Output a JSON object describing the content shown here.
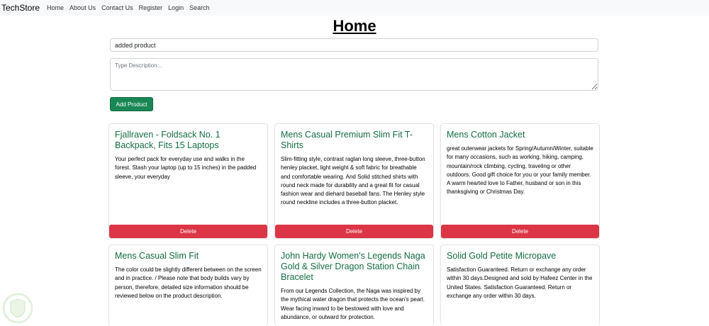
{
  "navbar": {
    "brand": "TechStore",
    "links": [
      "Home",
      "About Us",
      "Contact Us",
      "Register",
      "Login",
      "Search"
    ]
  },
  "page": {
    "title": "Home"
  },
  "form": {
    "title_value": "added product",
    "description_placeholder": "Type Description...",
    "add_button": "Add Product"
  },
  "products": [
    {
      "title": "Fjallraven - Foldsack No. 1 Backpack, Fits 15 Laptops",
      "description": "Your perfect pack for everyday use and walks in the forest. Stash your laptop (up to 15 inches) in the padded sleeve, your everyday",
      "delete_label": "Delete"
    },
    {
      "title": "Mens Casual Premium Slim Fit T-Shirts",
      "description": "Slim-fitting style, contrast raglan long sleeve, three-button henley placket, light weight & soft fabric for breathable and comfortable wearing. And Solid stitched shirts with round neck made for durability and a great fit for casual fashion wear and diehard baseball fans. The Henley style round neckline includes a three-button placket.",
      "delete_label": "Delete"
    },
    {
      "title": "Mens Cotton Jacket",
      "description": "great outerwear jackets for Spring/Autumn/Winter, suitable for many occasions, such as working, hiking, camping, mountain/rock climbing, cycling, traveling or other outdoors. Good gift choice for you or your family member. A warm hearted love to Father, husband or son in this thanksgiving or Christmas Day.",
      "delete_label": "Delete"
    },
    {
      "title": "Mens Casual Slim Fit",
      "description": "The color could be slightly different between on the screen and in practice. / Please note that body builds vary by person, therefore, detailed size information should be reviewed below on the product description."
    },
    {
      "title": "John Hardy Women's Legends Naga Gold & Silver Dragon Station Chain Bracelet",
      "description": "From our Legends Collection, the Naga was inspired by the mythical water dragon that protects the ocean's pearl. Wear facing inward to be bestowed with love and abundance, or outward for protection."
    },
    {
      "title": "Solid Gold Petite Micropave",
      "description": "Satisfaction Guaranteed. Return or exchange any order within 30 days.Designed and sold by Hafeez Center in the United States. Satisfaction Guaranteed. Return or exchange any order within 30 days."
    }
  ],
  "colors": {
    "success": "#198754",
    "danger": "#dc3545",
    "title_green": "#146c43",
    "navbar_bg": "#f8f9fa"
  }
}
